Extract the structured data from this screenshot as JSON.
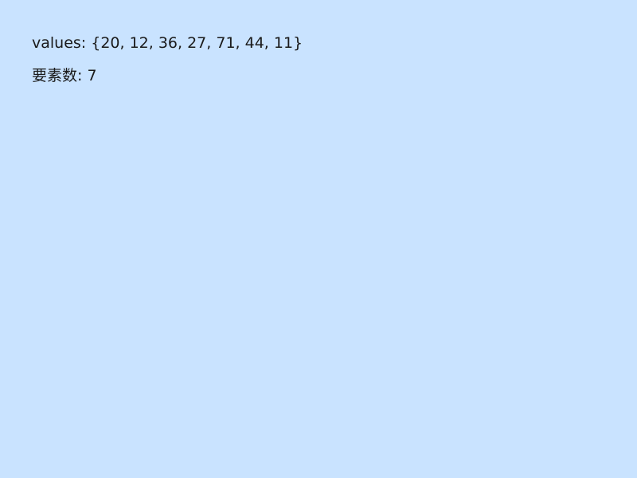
{
  "lines": {
    "values_text": "values: {20, 12, 36, 27, 71, 44, 11}",
    "count_text": "要素数: 7"
  },
  "colors": {
    "background": "#c9e3ff",
    "text": "#1a1a1a"
  }
}
